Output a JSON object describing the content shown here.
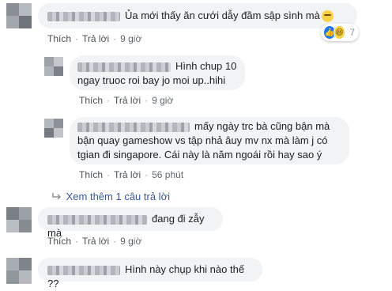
{
  "comments": [
    {
      "id": "c1",
      "text": "Ủa mới thấy ăn cưới dẫy đầm sập sình mà",
      "emoji": "confused-face",
      "actions": {
        "like": "Thích",
        "reply": "Trả lời",
        "time": "9 giờ"
      },
      "reactions": {
        "icons": [
          "like-icon",
          "haha-icon"
        ],
        "count": "7"
      }
    },
    {
      "id": "r1",
      "text": "Hình chup 10 ngay truoc roi bay jo moi up..hihi",
      "actions": {
        "like": "Thích",
        "reply": "Trả lời",
        "time": "9 giờ"
      }
    },
    {
      "id": "r2",
      "text": "mấy ngày trc bà cũng bận mà bận quay gameshow vs tập nhả âuy mv nx mà làm j có tgian đi singapore. Cái này là năm ngoái rồi hay sao ý",
      "actions": {
        "like": "Thích",
        "reply": "Trả lời",
        "time": "56 phút"
      }
    },
    {
      "id": "c2",
      "text": "đang đi zẫy mà",
      "actions": {
        "like": "Thích",
        "reply": "Trả lời",
        "time": "9 giờ"
      }
    },
    {
      "id": "c3",
      "text": "Hình này chụp khi nào thế ??"
    }
  ],
  "see_more_replies": "Xem thêm 1 câu trả lời",
  "colors": {
    "link": "#385898",
    "bubble": "#f2f3f5",
    "meta": "#606770"
  }
}
